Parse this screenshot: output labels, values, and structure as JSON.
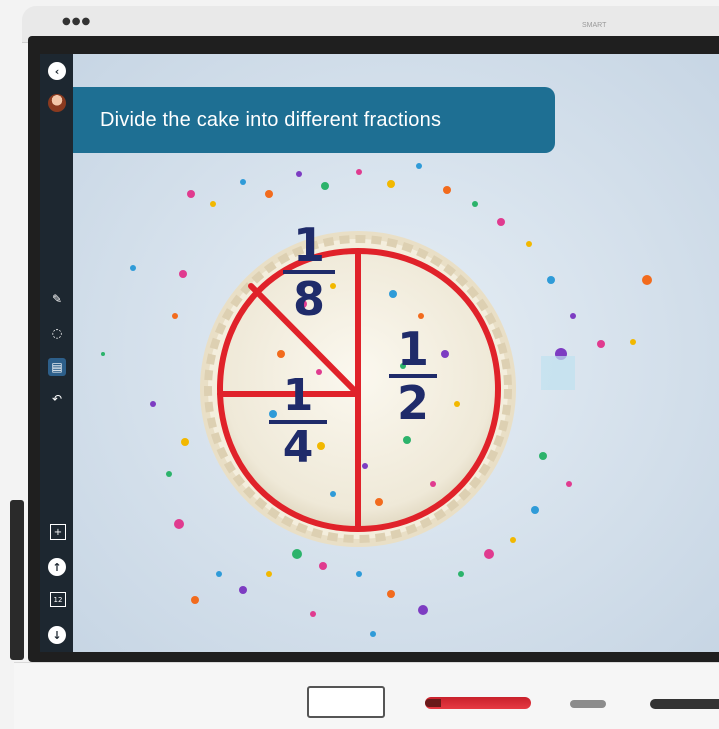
{
  "window": {
    "dots": "●●●",
    "brand": "SMART"
  },
  "lesson": {
    "title": "Divide the cake into different fractions"
  },
  "fractions": [
    {
      "numerator": "1",
      "denominator": "8"
    },
    {
      "numerator": "1",
      "denominator": "4"
    },
    {
      "numerator": "1",
      "denominator": "2"
    }
  ],
  "toolbar": {
    "icons": [
      "back-arrow-icon",
      "avatar",
      "pen-icon",
      "lasso-icon",
      "whiteboard-icon",
      "undo-icon",
      "add-page-icon",
      "page-up-icon",
      "page-number-icon",
      "page-down-icon"
    ],
    "page_number": "12"
  },
  "colors": {
    "accent": "#1e6f93",
    "ink_red": "#e0222a",
    "ink_navy": "#1f2b6a"
  }
}
